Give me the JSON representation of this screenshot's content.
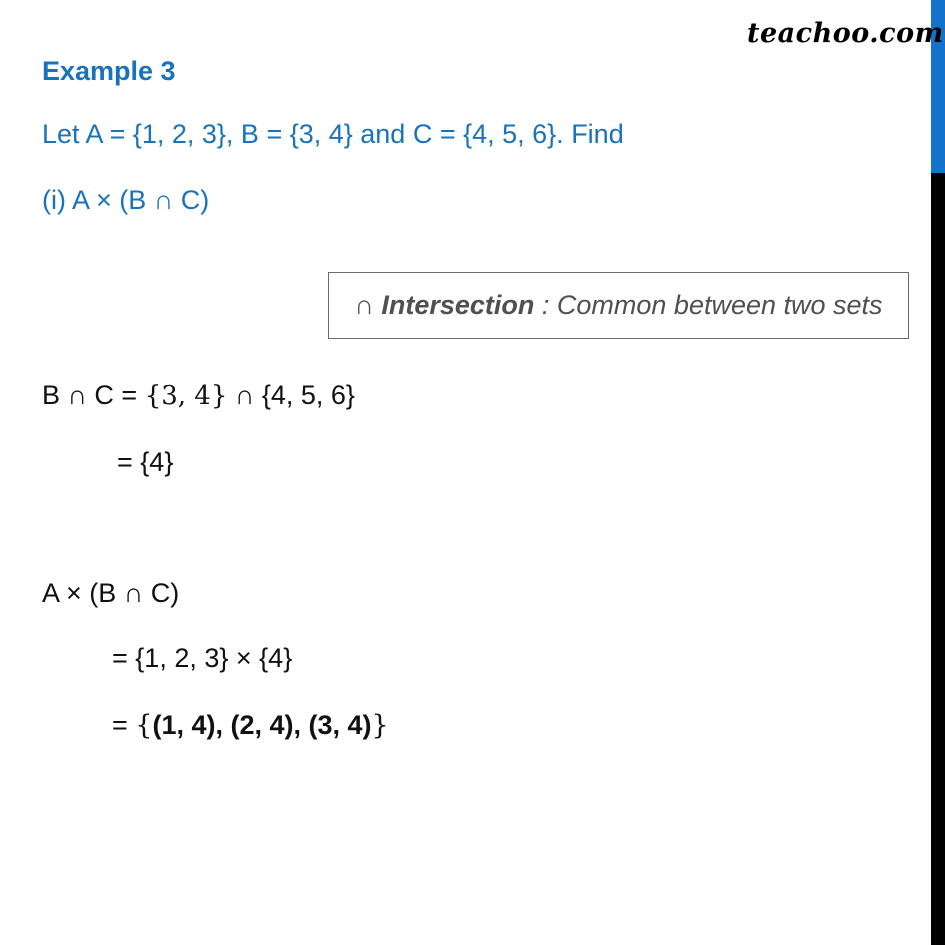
{
  "brand": {
    "logo_text": "teachoo.com",
    "accent_color": "#1473c9"
  },
  "header": {
    "title": "Example 3",
    "question": "Let A = {1, 2, 3}, B = {3, 4} and C = {4, 5, 6}. Find",
    "part": "(i)  A × (B ∩ C)"
  },
  "note": {
    "symbol": "∩",
    "term": "Intersection",
    "separator": " : ",
    "definition": "Common between two sets"
  },
  "solution": {
    "step1": {
      "lhs": "B ∩ C = ",
      "set1": "{3, 4}",
      "op": " ∩ ",
      "set2": "{4, 5, 6}"
    },
    "step2": {
      "prefix": "= ",
      "result": "{4}"
    },
    "step3": {
      "expr": "A × (B ∩ C)"
    },
    "step4": {
      "prefix": "= ",
      "set1": "{1, 2, 3}",
      "op": " × ",
      "set2": "{4}"
    },
    "step5": {
      "prefix": "= ",
      "open": "{",
      "result": "(1, 4), (2, 4), (3, 4)",
      "close": "}"
    }
  }
}
